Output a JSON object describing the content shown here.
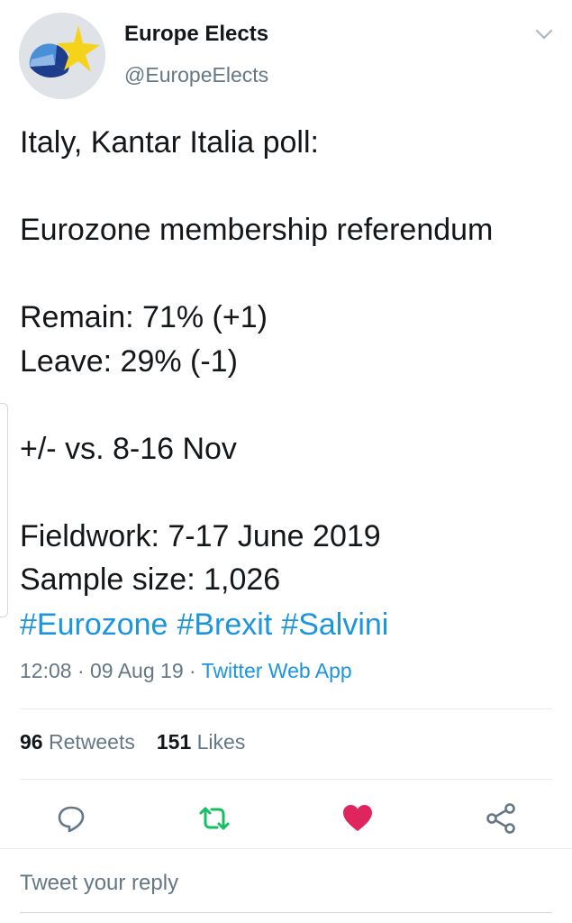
{
  "author": {
    "name": "Europe Elects",
    "handle": "@EuropeElects"
  },
  "tweet": {
    "lines": [
      "Italy, Kantar Italia poll:",
      "",
      "Eurozone membership referendum",
      "",
      "Remain: 71% (+1)",
      "Leave: 29% (-1)",
      "",
      "+/- vs. 8-16 Nov",
      "",
      "Fieldwork: 7-17 June 2019",
      "Sample size: 1,026"
    ],
    "hashtags": [
      "#Eurozone",
      "#Brexit",
      "#Salvini"
    ]
  },
  "meta": {
    "time": "12:08",
    "date": "09 Aug 19",
    "separator": "·",
    "source": "Twitter Web App"
  },
  "stats": {
    "retweets_count": "96",
    "retweets_label": "Retweets",
    "likes_count": "151",
    "likes_label": "Likes"
  },
  "actions": {
    "reply_icon": "speech-bubble-icon",
    "retweet_icon": "retweet-icon",
    "like_icon": "heart-icon",
    "share_icon": "share-icon",
    "retweet_color": "#17bf63",
    "like_color": "#e0245e"
  },
  "reply_box": {
    "placeholder": "Tweet your reply"
  },
  "colors": {
    "link": "#1b95e0",
    "secondary_text": "#657786",
    "primary_text": "#14171a",
    "avatar_star": "#f5d31c",
    "avatar_navy": "#1d3c8c",
    "avatar_light_blue": "#4a90d9"
  }
}
